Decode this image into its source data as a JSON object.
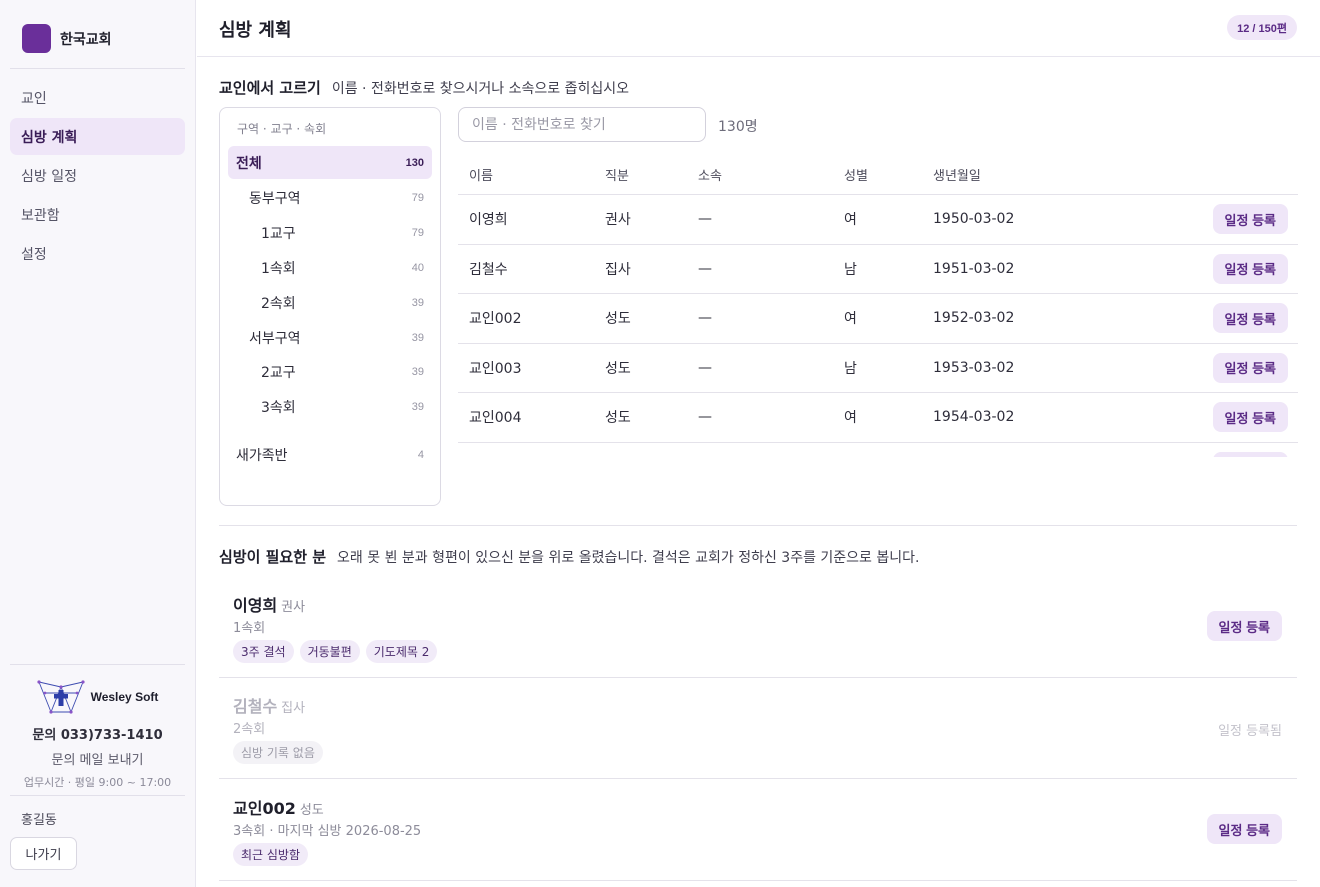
{
  "sidebar": {
    "church_name": "한국교회",
    "nav": [
      {
        "label": "교인"
      },
      {
        "label": "심방 계획"
      },
      {
        "label": "심방 일정"
      },
      {
        "label": "보관함"
      },
      {
        "label": "설정"
      }
    ],
    "vendor": "Wesley Soft",
    "phone": "문의 033)733-1410",
    "mail_link": "문의 메일 보내기",
    "hours": "업무시간 · 평일 9:00 ~ 17:00",
    "user": "홍길동",
    "logout": "나가기"
  },
  "header": {
    "title": "심방 계획",
    "quota": "12 / 150편"
  },
  "picker": {
    "title": "교인에서 고르기",
    "desc": "이름 · 전화번호로 찾으시거나 소속으로 좁히십시오",
    "tree_head": "구역 · 교구 · 속회",
    "tree": [
      {
        "label": "전체",
        "count": "130"
      },
      {
        "label": "동부구역",
        "count": "79"
      },
      {
        "label": "1교구",
        "count": "79"
      },
      {
        "label": "1속회",
        "count": "40"
      },
      {
        "label": "2속회",
        "count": "39"
      },
      {
        "label": "서부구역",
        "count": "39"
      },
      {
        "label": "2교구",
        "count": "39"
      },
      {
        "label": "3속회",
        "count": "39"
      },
      {
        "label": "새가족반",
        "count": "4"
      }
    ],
    "search_placeholder": "이름 · 전화번호로 찾기",
    "result_count": "130명",
    "columns": [
      "이름",
      "직분",
      "소속",
      "성별",
      "생년월일"
    ],
    "rows": [
      {
        "name": "이영희",
        "role": "권사",
        "group": "—",
        "gender": "여",
        "birth": "1950-03-02",
        "action": "일정 등록"
      },
      {
        "name": "김철수",
        "role": "집사",
        "group": "—",
        "gender": "남",
        "birth": "1951-03-02",
        "action": "일정 등록"
      },
      {
        "name": "교인002",
        "role": "성도",
        "group": "—",
        "gender": "여",
        "birth": "1952-03-02",
        "action": "일정 등록"
      },
      {
        "name": "교인003",
        "role": "성도",
        "group": "—",
        "gender": "남",
        "birth": "1953-03-02",
        "action": "일정 등록"
      },
      {
        "name": "교인004",
        "role": "성도",
        "group": "—",
        "gender": "여",
        "birth": "1954-03-02",
        "action": "일정 등록"
      }
    ]
  },
  "needs": {
    "title": "심방이 필요한 분",
    "desc": "오래 못 뵌 분과 형편이 있으신 분을 위로 올렸습니다. 결석은 교회가 정하신 3주를 기준으로 봅니다.",
    "items": [
      {
        "name": "이영희",
        "role": "권사",
        "sub": "1속회",
        "tags": [
          "3주 결석",
          "거동불편",
          "기도제목 2"
        ],
        "action": "일정 등록"
      },
      {
        "name": "김철수",
        "role": "집사",
        "sub": "2속회",
        "tags": [
          "심방 기록 없음"
        ],
        "action": "일정 등록됨"
      },
      {
        "name": "교인002",
        "role": "성도",
        "sub": "3속회 · 마지막 심방 2026-08-25",
        "tags": [
          "최근 심방함"
        ],
        "action": "일정 등록"
      }
    ]
  },
  "colors": {
    "accent": "#6a2f9a",
    "accent_soft": "#efe6f8",
    "accent_text": "#5b2b86"
  }
}
